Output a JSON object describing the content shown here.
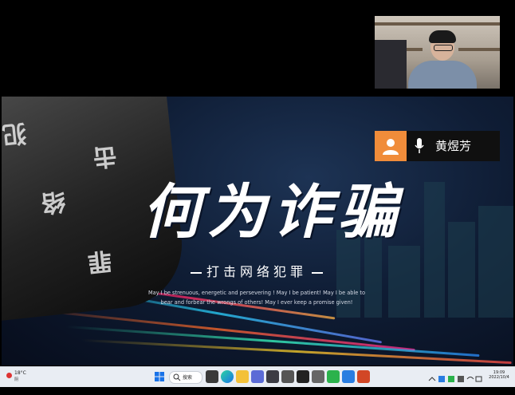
{
  "slide": {
    "title": "何为诈骗",
    "subtitle": "打击网络犯罪",
    "motto_line1": "May I be strenuous, energetic and persevering ! May I be patient! May I be able to",
    "motto_line2": "bear and forbear the wrongs of others! May I ever keep a promise given!"
  },
  "participant": {
    "name": "黄煜芳"
  },
  "taskbar": {
    "weather_temp": "18°C",
    "weather_desc": "阴",
    "search_label": "搜索",
    "clock_time": "19:09",
    "clock_date": "2022/10/4"
  },
  "colors": {
    "avatar_bg": "#f08c3a",
    "slide_bg": "#0f1d35",
    "taskbar_bg": "#e9edf3"
  }
}
